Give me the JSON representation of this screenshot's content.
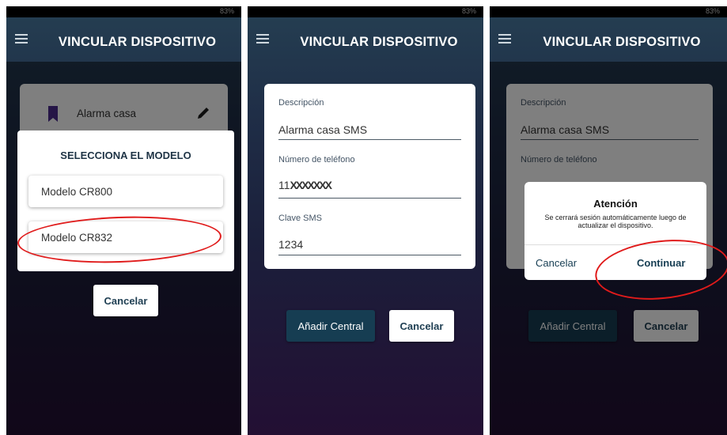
{
  "app": {
    "title": "VINCULAR DISPOSITIVO",
    "battery": "83%"
  },
  "panel1": {
    "device_name": "Alarma casa",
    "dialog_title": "SELECCIONA EL MODELO",
    "options": [
      "Modelo CR800",
      "Modelo CR832"
    ],
    "cancel_label": "Cancelar"
  },
  "panel2": {
    "description_label": "Descripción",
    "description_value": "Alarma casa SMS",
    "phone_label": "Número de teléfono",
    "phone_value": "11",
    "phone_redacted": "XXXXXXX",
    "sms_key_label": "Clave SMS",
    "sms_key_value": "1234",
    "add_label": "Añadir Central",
    "cancel_label": "Cancelar"
  },
  "panel3": {
    "description_label": "Descripción",
    "description_value": "Alarma casa SMS",
    "phone_label": "Número de teléfono",
    "dialog_title": "Atención",
    "dialog_message": "Se cerrará sesión automáticamente luego de actualizar el dispositivo.",
    "dialog_cancel": "Cancelar",
    "dialog_continue": "Continuar",
    "add_label": "Añadir Central",
    "cancel_label": "Cancelar"
  },
  "colors": {
    "accent_dark": "#163d52",
    "highlight_red": "#e01b1b",
    "bg_top": "#253f52",
    "bg_bottom": "#230f33"
  },
  "icons": [
    "menu-icon",
    "bookmark-icon",
    "pencil-icon"
  ]
}
